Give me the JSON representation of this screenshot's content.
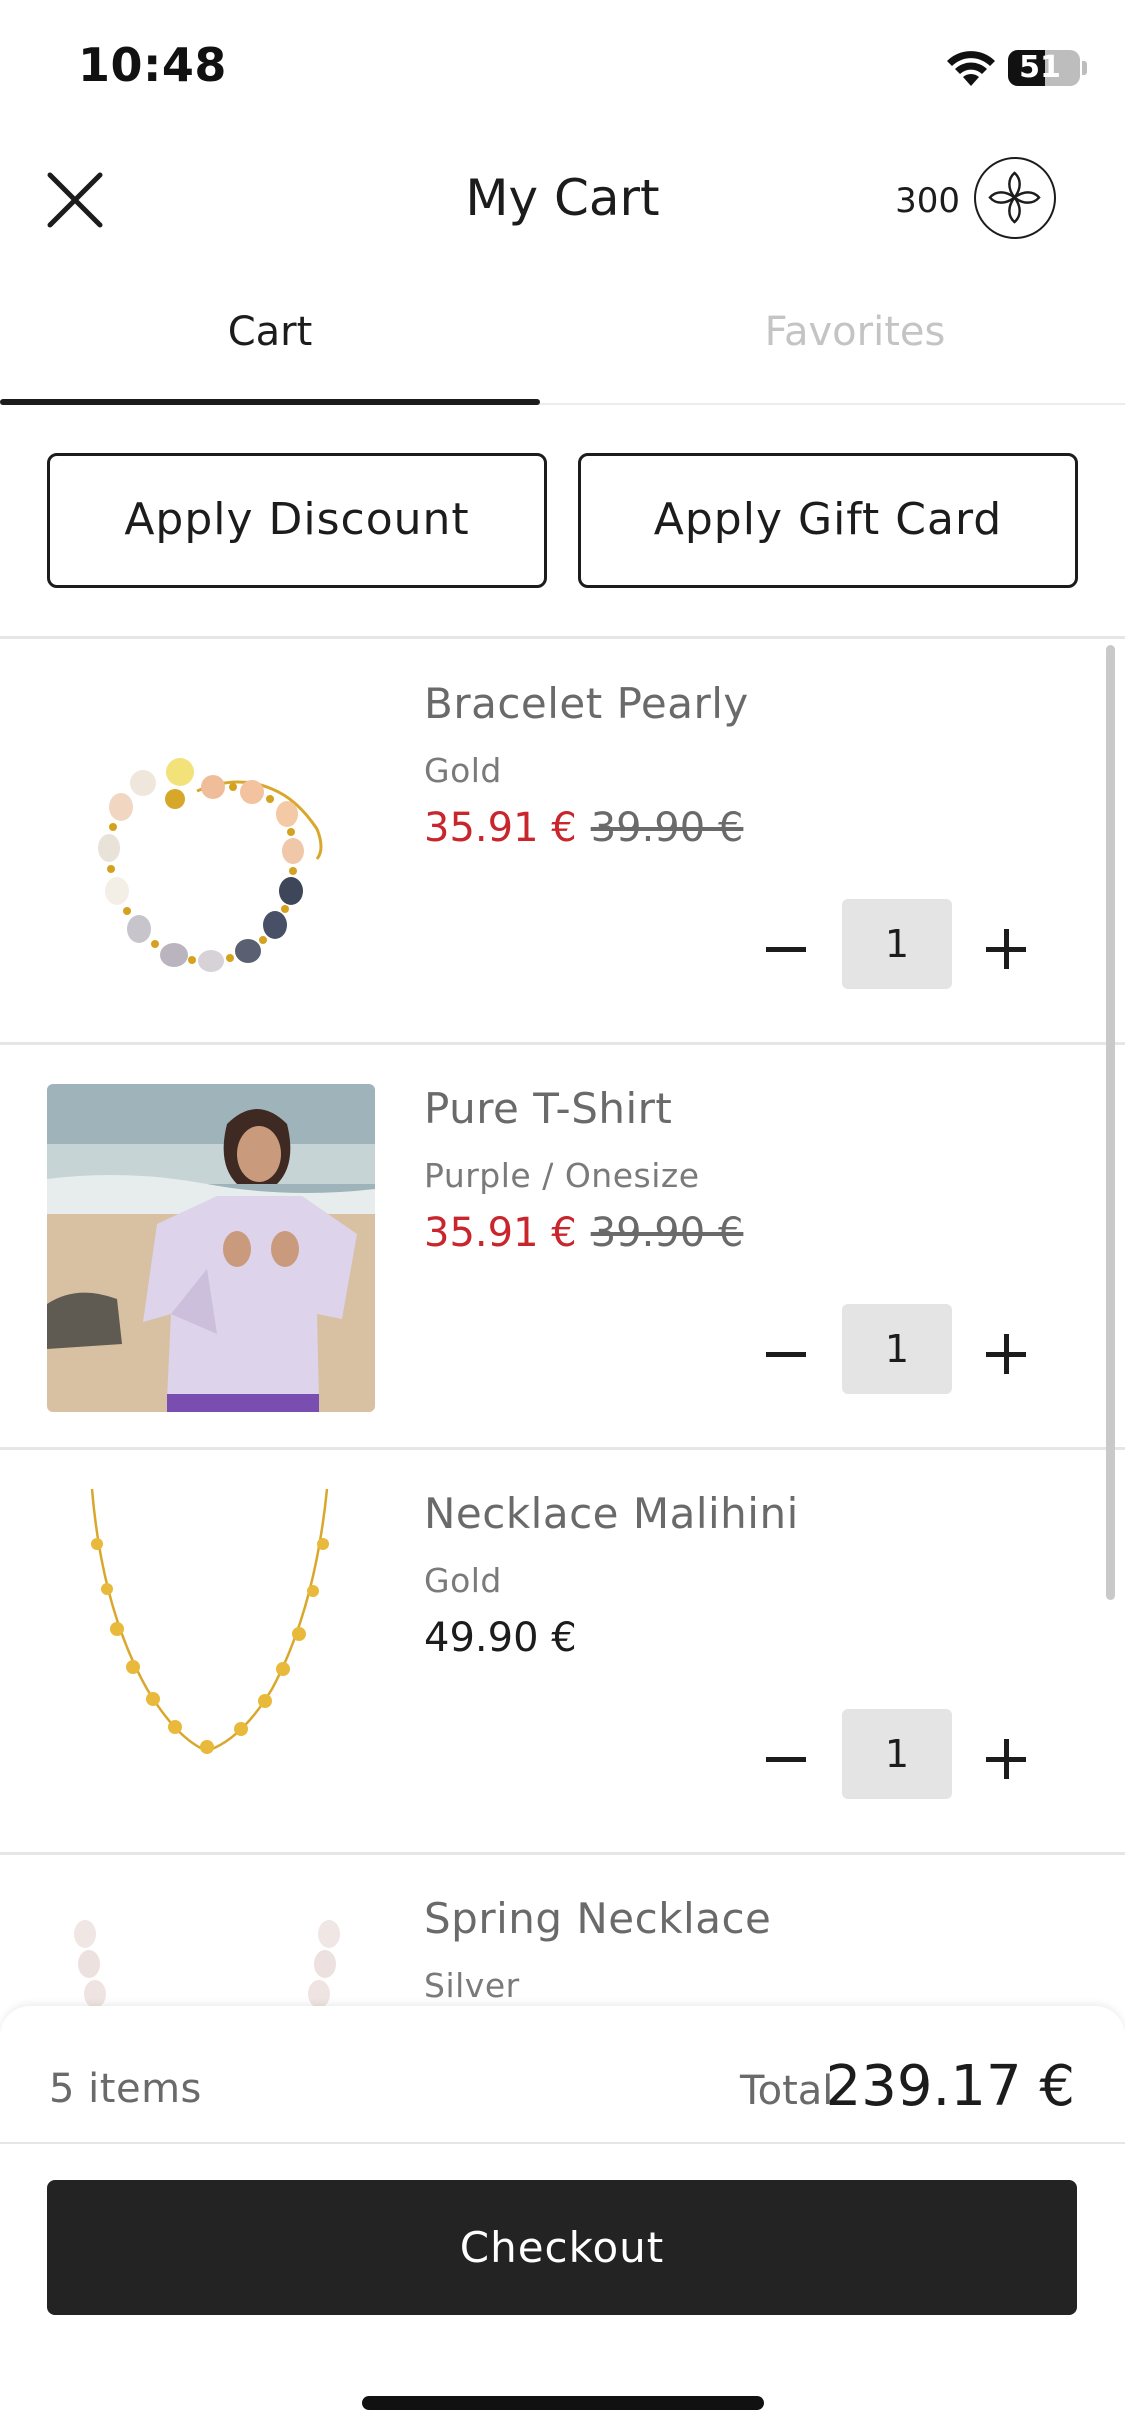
{
  "status_bar": {
    "time": "10:48",
    "battery": "51",
    "battery_level": 0.51
  },
  "header": {
    "title": "My Cart",
    "points": "300",
    "close_icon": "close-icon",
    "logo_icon": "flower-logo-icon"
  },
  "tabs": [
    {
      "label": "Cart",
      "active": true
    },
    {
      "label": "Favorites",
      "active": false
    }
  ],
  "actions": {
    "discount_label": "Apply Discount",
    "gift_card_label": "Apply Gift Card"
  },
  "items": [
    {
      "name": "Bracelet Pearly",
      "variant": "Gold",
      "sale_price": "35.91 €",
      "original_price": "39.90 €",
      "quantity": "1"
    },
    {
      "name": "Pure T-Shirt",
      "variant": "Purple / Onesize",
      "sale_price": "35.91 €",
      "original_price": "39.90 €",
      "quantity": "1"
    },
    {
      "name": "Necklace Malihini",
      "variant": "Gold",
      "price": "49.90 €",
      "quantity": "1"
    },
    {
      "name": "Spring Necklace",
      "variant": "Silver"
    }
  ],
  "summary": {
    "items_count": "5 items",
    "total_label": "Total",
    "total_value": "239.17 €",
    "checkout_label": "Checkout"
  },
  "colors": {
    "sale": "#c8262c",
    "checkout_bg": "#232323",
    "text": "#1c1c1c",
    "muted": "#6a6a6a"
  }
}
